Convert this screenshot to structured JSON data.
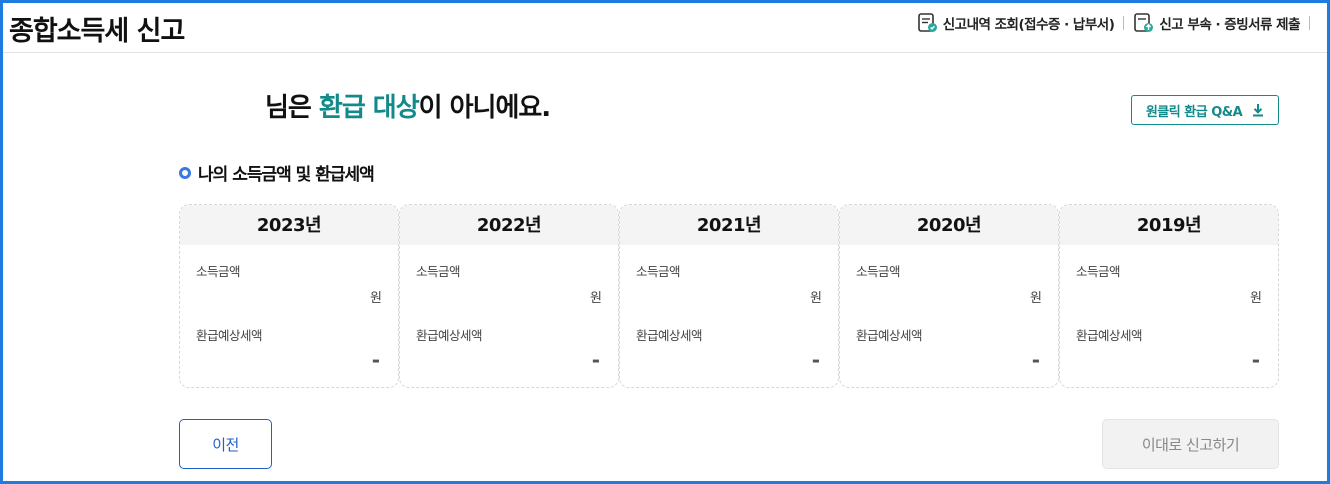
{
  "header": {
    "title": "종합소득세 신고",
    "links": [
      {
        "label": "신고내역 조회(접수증 · 납부서)",
        "icon": "document-search-icon"
      },
      {
        "label": "신고 부속 · 증빙서류 제출",
        "icon": "document-upload-icon"
      }
    ]
  },
  "main": {
    "headline_prefix": "님은 ",
    "headline_accent": "환급 대상",
    "headline_suffix": "이 아니에요.",
    "qa_button": {
      "label": "원클릭 환급 Q&A",
      "icon": "download-icon"
    },
    "section_title": "나의 소득금액 및 환급세액",
    "cards": [
      {
        "year": "2023년",
        "income_label": "소득금액",
        "income_unit": "원",
        "refund_label": "환급예상세액",
        "refund_value": "-"
      },
      {
        "year": "2022년",
        "income_label": "소득금액",
        "income_unit": "원",
        "refund_label": "환급예상세액",
        "refund_value": "-"
      },
      {
        "year": "2021년",
        "income_label": "소득금액",
        "income_unit": "원",
        "refund_label": "환급예상세액",
        "refund_value": "-"
      },
      {
        "year": "2020년",
        "income_label": "소득금액",
        "income_unit": "원",
        "refund_label": "환급예상세액",
        "refund_value": "-"
      },
      {
        "year": "2019년",
        "income_label": "소득금액",
        "income_unit": "원",
        "refund_label": "환급예상세액",
        "refund_value": "-"
      }
    ]
  },
  "footer": {
    "prev_label": "이전",
    "submit_label": "이대로 신고하기"
  },
  "colors": {
    "accent": "#138a8a",
    "frame": "#1e7be0",
    "primary": "#1e62c8"
  }
}
